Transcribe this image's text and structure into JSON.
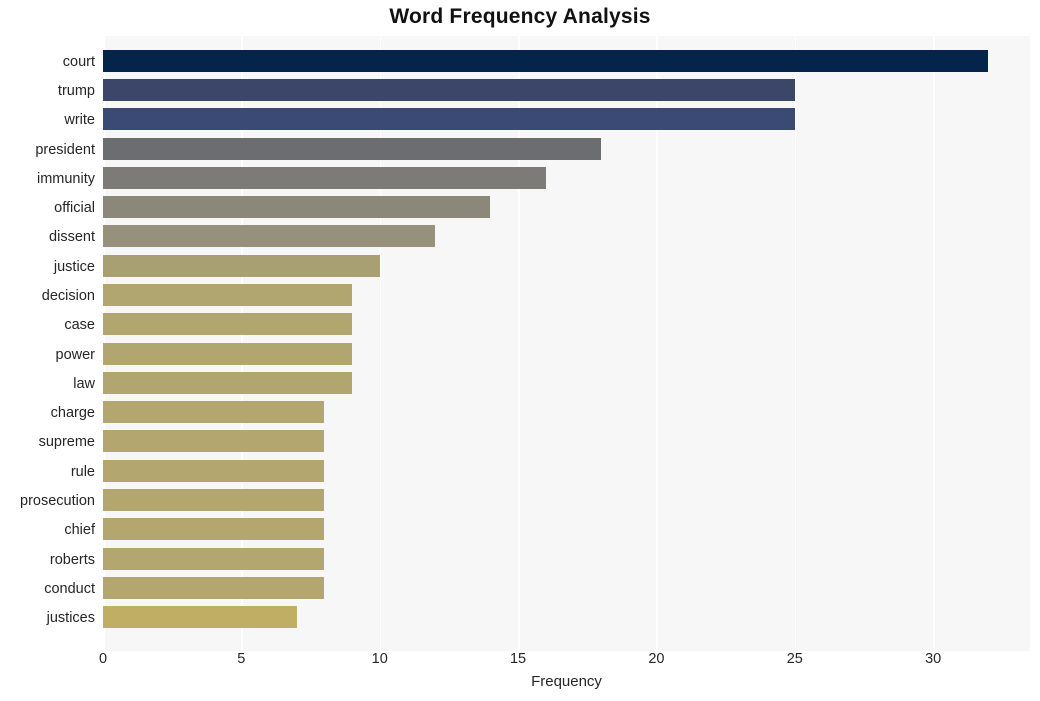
{
  "chart_data": {
    "type": "bar",
    "orientation": "horizontal",
    "title": "Word Frequency Analysis",
    "xlabel": "Frequency",
    "ylabel": "",
    "xlim": [
      0,
      33.5
    ],
    "xticks": [
      0,
      5,
      10,
      15,
      20,
      25,
      30
    ],
    "xticklabels": [
      "0",
      "5",
      "10",
      "15",
      "20",
      "25",
      "30"
    ],
    "grid": "vertical-white",
    "legend": "none",
    "categories": [
      "court",
      "trump",
      "write",
      "president",
      "immunity",
      "official",
      "dissent",
      "justice",
      "decision",
      "case",
      "power",
      "law",
      "charge",
      "supreme",
      "rule",
      "prosecution",
      "chief",
      "roberts",
      "conduct",
      "justices"
    ],
    "values": [
      32,
      25,
      25,
      18,
      16,
      14,
      12,
      10,
      9,
      9,
      9,
      9,
      8,
      8,
      8,
      8,
      8,
      8,
      8,
      7
    ],
    "bar_colors": [
      "#04244c",
      "#3b4668",
      "#3b4a74",
      "#6c6d71",
      "#7d7b77",
      "#8b887a",
      "#96917a",
      "#a89f73",
      "#b1a670",
      "#b1a670",
      "#b1a670",
      "#b1a670",
      "#b3a76f",
      "#b3a76f",
      "#b3a76f",
      "#b3a76f",
      "#b3a76f",
      "#b3a76f",
      "#b3a76f",
      "#bfae63"
    ]
  },
  "style": {
    "plot_background": "#f7f7f7",
    "figure_background": "#ffffff",
    "gridline_color": "#ffffff",
    "text_color": "#262626",
    "title_color": "#111111"
  }
}
